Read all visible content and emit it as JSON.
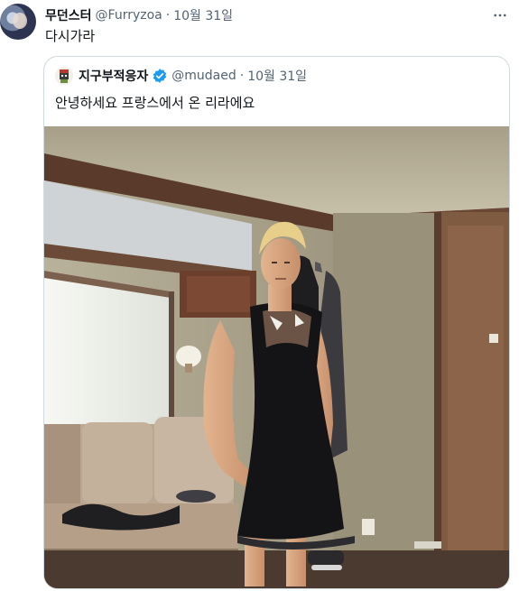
{
  "tweet": {
    "author": {
      "display_name": "무던스터",
      "handle": "@Furryzoa",
      "avatar_icon": "profile-avatar"
    },
    "separator": "·",
    "date": "10월 31일",
    "text": "다시가라",
    "more_icon": "ellipsis-icon"
  },
  "quoted_tweet": {
    "author": {
      "display_name": "지구부적응자",
      "handle": "@mudaed",
      "verified": true,
      "verified_color": "#1d9bf0",
      "avatar_icon": "profile-avatar"
    },
    "separator": "·",
    "date": "10월 31일",
    "text": "안녕하세요 프랑스에서 온 리라에요",
    "media": {
      "type": "photo"
    }
  },
  "colors": {
    "text_primary": "#0f1419",
    "text_secondary": "#536471",
    "border": "#cfd9de",
    "accent": "#1d9bf0"
  }
}
